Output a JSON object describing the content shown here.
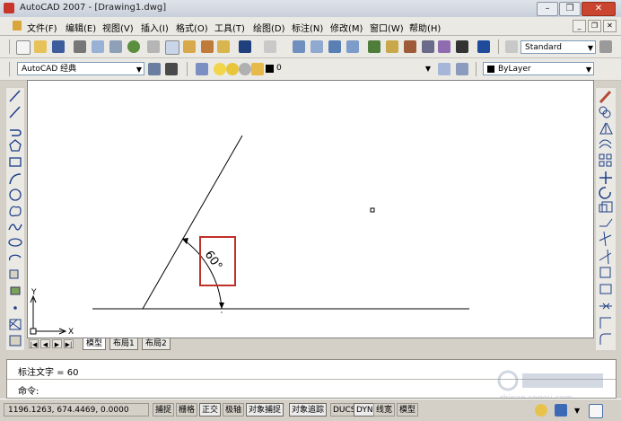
{
  "window": {
    "title": "AutoCAD 2007 - [Drawing1.dwg]",
    "minimize_glyph": "–",
    "restore_glyph": "❐",
    "close_glyph": "✕"
  },
  "menu": {
    "items": [
      "文件(F)",
      "编辑(E)",
      "视图(V)",
      "插入(I)",
      "格式(O)",
      "工具(T)",
      "绘图(D)",
      "标注(N)",
      "修改(M)",
      "窗口(W)",
      "帮助(H)"
    ],
    "mdi_minimize": "_",
    "mdi_restore": "❐",
    "mdi_close": "✕"
  },
  "toolbar1": {
    "text_style_value": "Standard"
  },
  "toolbar2": {
    "workspace_value": "AutoCAD 经典",
    "layer_value": "0",
    "color_value": "ByLayer"
  },
  "drawing": {
    "ucs_x_label": "X",
    "ucs_y_label": "Y",
    "dimension_text": "60°"
  },
  "layout_tabs": {
    "tabs": [
      "模型",
      "布局1",
      "布局2"
    ],
    "active": "模型",
    "nav": [
      "|◀",
      "◀",
      "▶",
      "▶|"
    ]
  },
  "command": {
    "history_line": "标注文字 = 60",
    "prompt": "命令:"
  },
  "status": {
    "coordinates": "1196.1263, 674.4469, 0.0000",
    "buttons": [
      {
        "label": "捕捉",
        "on": false
      },
      {
        "label": "栅格",
        "on": false
      },
      {
        "label": "正交",
        "on": true
      },
      {
        "label": "极轴",
        "on": false
      },
      {
        "label": "对象捕捉",
        "on": true
      },
      {
        "label": "对象追踪",
        "on": true
      },
      {
        "label": "DUCS",
        "on": false
      },
      {
        "label": "DYN",
        "on": true
      },
      {
        "label": "线宽",
        "on": false
      },
      {
        "label": "模型",
        "on": false
      }
    ]
  },
  "watermark": {
    "text": "zhinan.sogou.com"
  },
  "colors": {
    "highlight_box": "#c0302a",
    "drawing_line": "#000000"
  }
}
